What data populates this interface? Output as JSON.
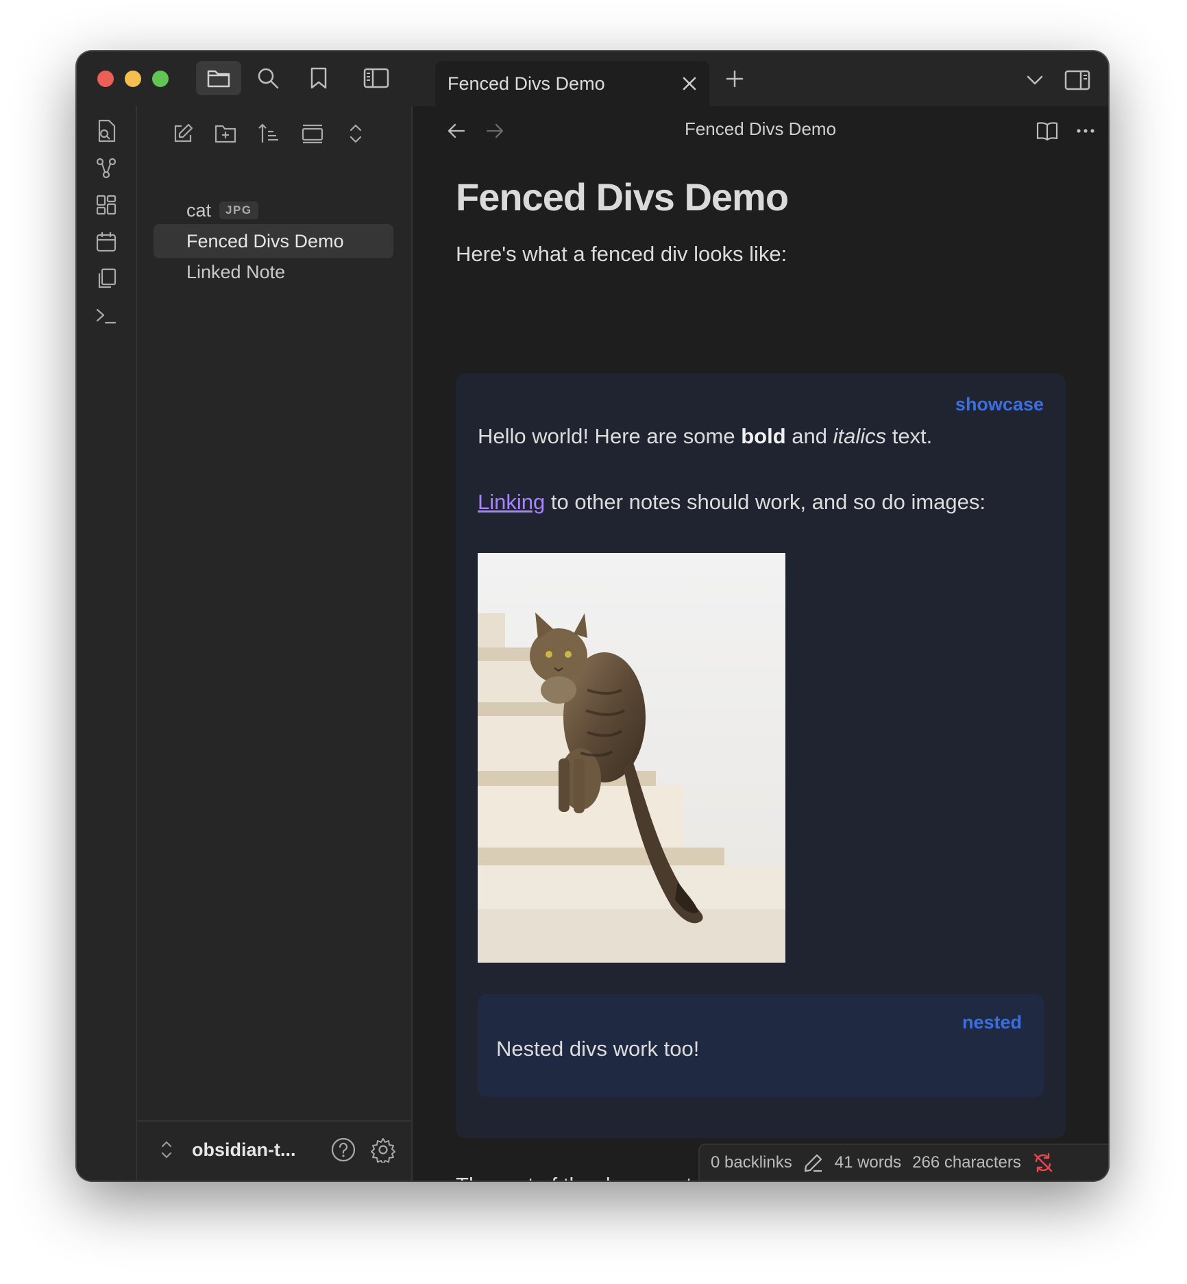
{
  "window": {
    "tab_title": "Fenced Divs Demo",
    "view_title": "Fenced Divs Demo"
  },
  "files": [
    {
      "name": "cat",
      "ext": "JPG"
    },
    {
      "name": "Fenced Divs Demo",
      "active": true
    },
    {
      "name": "Linked Note"
    }
  ],
  "vault": {
    "name": "obsidian-t..."
  },
  "doc": {
    "title": "Fenced Divs Demo",
    "intro": "Here's what a fenced div looks like:",
    "showcase": {
      "label": "showcase",
      "line1_a": "Hello world! Here are some ",
      "line1_bold": "bold",
      "line1_b": " and ",
      "line1_italic": "italics",
      "line1_c": " text.",
      "link_text": "Linking",
      "line2_rest": " to other notes should work, and so do images:",
      "nested": {
        "label": "nested",
        "text": "Nested divs work too!"
      }
    },
    "outro": "The rest of the document ..."
  },
  "status": {
    "backlinks": "0 backlinks",
    "words": "41 words",
    "characters": "266 characters"
  },
  "colors": {
    "accent_link": "#a882ff",
    "callout_label": "#3b6fe0",
    "callout_bg": "#1f2430",
    "nested_bg": "#1f2a42",
    "sync_error": "#e5484d"
  }
}
